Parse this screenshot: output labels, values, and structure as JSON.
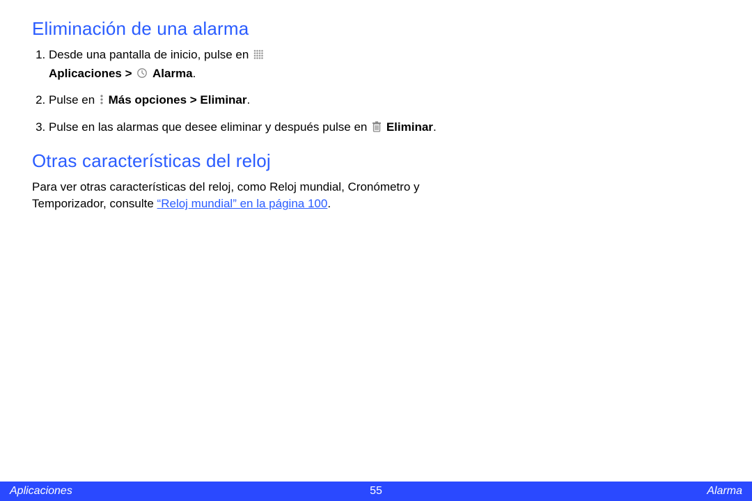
{
  "sections": {
    "delete_alarm": {
      "heading": "Eliminación de una alarma",
      "steps": {
        "s1": {
          "p1": "Desde una pantalla de inicio, pulse en ",
          "bold1": "Aplicaciones > ",
          "bold2": " Alarma",
          "tail": "."
        },
        "s2": {
          "p1": "Pulse en ",
          "bold": "Más opciones > Eliminar",
          "tail": "."
        },
        "s3": {
          "p1": "Pulse en las alarmas que desee eliminar y después pulse en ",
          "bold": " Eliminar",
          "tail": "."
        }
      }
    },
    "other_features": {
      "heading": "Otras características del reloj",
      "para": {
        "p1": "Para ver otras características del reloj, como Reloj mundial, Cronómetro y Temporizador, consulte ",
        "link": "“Reloj mundial” en la página 100",
        "tail": "."
      }
    }
  },
  "footer": {
    "left": "Aplicaciones",
    "center": "55",
    "right": "Alarma"
  },
  "icons": {
    "apps": "apps-grid-icon",
    "clock": "clock-icon",
    "more": "more-vertical-icon",
    "trash": "trash-icon"
  }
}
